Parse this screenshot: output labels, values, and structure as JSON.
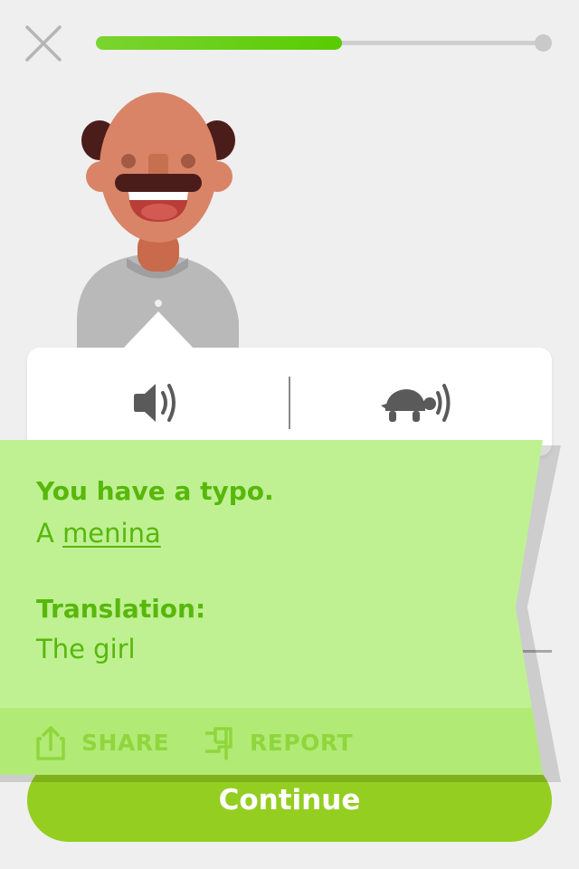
{
  "lesson": {
    "progress_fraction": 0.55
  },
  "icons": {
    "close": "close-icon",
    "speaker": "speaker-icon",
    "slow": "turtle-speaker-icon",
    "share": "share-icon",
    "report": "flag-icon"
  },
  "feedback": {
    "title": "You have a typo.",
    "answer_prefix": "A ",
    "answer_typo": "menina",
    "translation_title": "Translation:",
    "translation": "The girl",
    "share_label": "SHARE",
    "report_label": "REPORT"
  },
  "continue_label": "Continue",
  "colors": {
    "accent_green": "#58cc02",
    "feedback_bg": "#bff193",
    "feedback_text": "#58b70b",
    "continue_bg": "#94ce21"
  }
}
